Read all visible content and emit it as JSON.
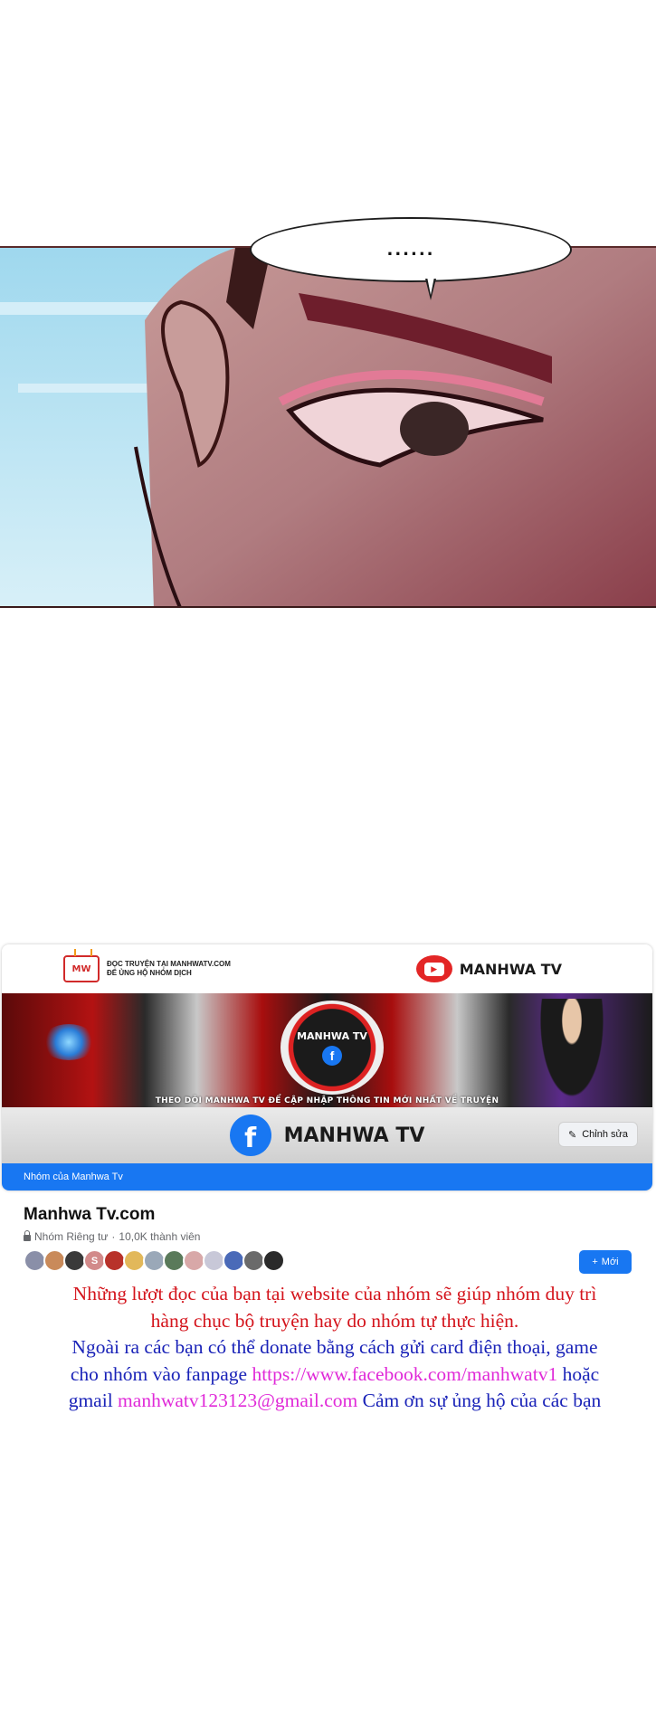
{
  "speech_bubble": {
    "text": "......"
  },
  "fb_cover": {
    "mw_logo_text": "MW",
    "mw_line1": "ĐỌC TRUYỆN TẠI MANHWATV.COM",
    "mw_line2": "ĐỂ ỦNG HỘ NHÓM DỊCH",
    "top_brand": "MANHWA TV",
    "banner_brand": "MANHWA TV",
    "banner_caption": "THEO DÕI MANHWA TV ĐỂ CẬP NHẬP THÔNG TIN MỚI NHẤT VỀ TRUYỆN",
    "bottom_brand": "MANHWA TV",
    "edit_button": "Chỉnh sửa",
    "group_bar": "Nhóm của Manhwa Tv",
    "colors": {
      "facebook_blue": "#1877f2",
      "youtube_red": "#e32626"
    }
  },
  "group": {
    "name": "Manhwa Tv.com",
    "privacy": "Nhóm Riêng tư",
    "separator": "·",
    "members": "10,0K thành viên",
    "new_button": "Mới",
    "new_icon": "+",
    "avatar_letter": "S"
  },
  "notice": {
    "line1": "Những lượt đọc của bạn tại website của nhóm sẽ giúp nhóm duy trì",
    "line2": "hàng chục bộ truyện hay do nhóm tự thực hiện.",
    "line3": "Ngoài ra các bạn có thể donate bằng cách gửi card điện thoại, game",
    "line4a": "cho nhóm vào fanpage ",
    "link_fanpage": "https://www.facebook.com/manhwatv1",
    "line4b": " hoặc",
    "line5a": "gmail ",
    "link_gmail": "manhwatv123123@gmail.com",
    "line5b": " Cảm ơn sự ủng hộ của các bạn",
    "colors": {
      "red": "#d4141c",
      "blue": "#1a23b8",
      "pink": "#e02ad8"
    }
  }
}
